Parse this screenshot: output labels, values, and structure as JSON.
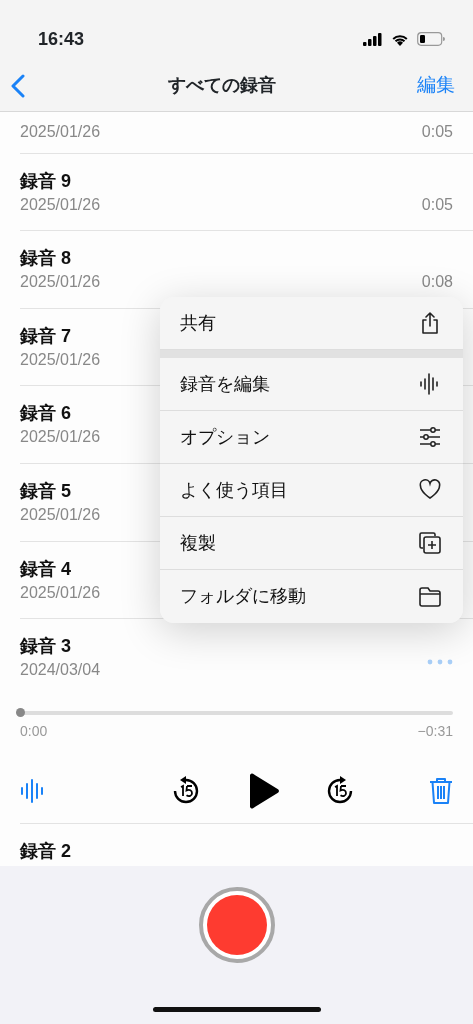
{
  "status_bar": {
    "time": "16:43"
  },
  "nav": {
    "title": "すべての録音",
    "edit": "編集"
  },
  "recordings": [
    {
      "date": "2025/01/26",
      "duration": "0:05"
    },
    {
      "title": "録音 9",
      "date": "2025/01/26",
      "duration": "0:05"
    },
    {
      "title": "録音 8",
      "date": "2025/01/26",
      "duration": "0:08"
    },
    {
      "title": "録音 7",
      "date": "2025/01/26"
    },
    {
      "title": "録音 6",
      "date": "2025/01/26"
    },
    {
      "title": "録音 5",
      "date": "2025/01/26"
    },
    {
      "title": "録音 4",
      "date": "2025/01/26"
    },
    {
      "title": "録音 3",
      "date": "2024/03/04",
      "expanded": true,
      "player": {
        "level": 0,
        "elapsed": "0:00",
        "remaining": "−0:31"
      }
    },
    {
      "title": "録音 2"
    }
  ],
  "menu": {
    "groups": [
      [
        "共有"
      ],
      [
        "録音を編集",
        "オプション",
        "よく使う項目",
        "複製",
        "フォルダに移動"
      ]
    ]
  }
}
